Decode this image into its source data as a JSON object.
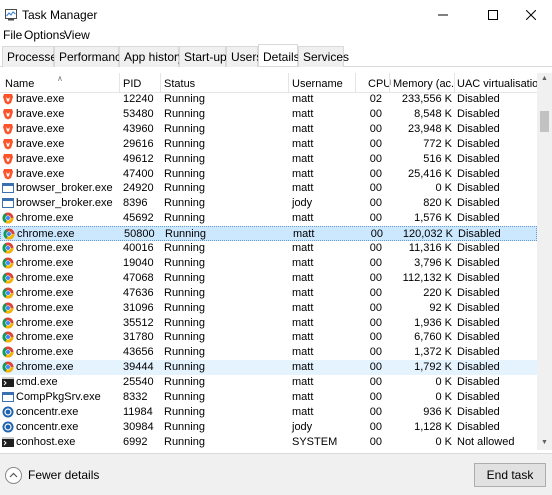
{
  "window": {
    "title": "Task Manager"
  },
  "menu": {
    "file": "File",
    "options": "Options",
    "view": "View"
  },
  "tabs": [
    {
      "label": "Processes"
    },
    {
      "label": "Performance"
    },
    {
      "label": "App history"
    },
    {
      "label": "Start-up"
    },
    {
      "label": "Users"
    },
    {
      "label": "Details",
      "active": true
    },
    {
      "label": "Services"
    }
  ],
  "columns": {
    "name": "Name",
    "pid": "PID",
    "status": "Status",
    "username": "Username",
    "cpu": "CPU",
    "memory": "Memory (ac...",
    "uac": "UAC virtualisation"
  },
  "rows": [
    {
      "name": "brave.exe",
      "pid": "12240",
      "status": "Running",
      "user": "matt",
      "cpu": "02",
      "mem": "233,556 K",
      "uac": "Disabled",
      "icon": "brave"
    },
    {
      "name": "brave.exe",
      "pid": "53480",
      "status": "Running",
      "user": "matt",
      "cpu": "00",
      "mem": "8,548 K",
      "uac": "Disabled",
      "icon": "brave"
    },
    {
      "name": "brave.exe",
      "pid": "43960",
      "status": "Running",
      "user": "matt",
      "cpu": "00",
      "mem": "23,948 K",
      "uac": "Disabled",
      "icon": "brave"
    },
    {
      "name": "brave.exe",
      "pid": "29616",
      "status": "Running",
      "user": "matt",
      "cpu": "00",
      "mem": "772 K",
      "uac": "Disabled",
      "icon": "brave"
    },
    {
      "name": "brave.exe",
      "pid": "49612",
      "status": "Running",
      "user": "matt",
      "cpu": "00",
      "mem": "516 K",
      "uac": "Disabled",
      "icon": "brave"
    },
    {
      "name": "brave.exe",
      "pid": "47400",
      "status": "Running",
      "user": "matt",
      "cpu": "00",
      "mem": "25,416 K",
      "uac": "Disabled",
      "icon": "brave"
    },
    {
      "name": "browser_broker.exe",
      "pid": "24920",
      "status": "Running",
      "user": "matt",
      "cpu": "00",
      "mem": "0 K",
      "uac": "Disabled",
      "icon": "app"
    },
    {
      "name": "browser_broker.exe",
      "pid": "8396",
      "status": "Running",
      "user": "jody",
      "cpu": "00",
      "mem": "820 K",
      "uac": "Disabled",
      "icon": "app"
    },
    {
      "name": "chrome.exe",
      "pid": "45692",
      "status": "Running",
      "user": "matt",
      "cpu": "00",
      "mem": "1,576 K",
      "uac": "Disabled",
      "icon": "chrome"
    },
    {
      "name": "chrome.exe",
      "pid": "50800",
      "status": "Running",
      "user": "matt",
      "cpu": "00",
      "mem": "120,032 K",
      "uac": "Disabled",
      "icon": "chrome",
      "state": "selected"
    },
    {
      "name": "chrome.exe",
      "pid": "40016",
      "status": "Running",
      "user": "matt",
      "cpu": "00",
      "mem": "11,316 K",
      "uac": "Disabled",
      "icon": "chrome"
    },
    {
      "name": "chrome.exe",
      "pid": "19040",
      "status": "Running",
      "user": "matt",
      "cpu": "00",
      "mem": "3,796 K",
      "uac": "Disabled",
      "icon": "chrome"
    },
    {
      "name": "chrome.exe",
      "pid": "47068",
      "status": "Running",
      "user": "matt",
      "cpu": "00",
      "mem": "112,132 K",
      "uac": "Disabled",
      "icon": "chrome"
    },
    {
      "name": "chrome.exe",
      "pid": "47636",
      "status": "Running",
      "user": "matt",
      "cpu": "00",
      "mem": "220 K",
      "uac": "Disabled",
      "icon": "chrome"
    },
    {
      "name": "chrome.exe",
      "pid": "31096",
      "status": "Running",
      "user": "matt",
      "cpu": "00",
      "mem": "92 K",
      "uac": "Disabled",
      "icon": "chrome"
    },
    {
      "name": "chrome.exe",
      "pid": "35512",
      "status": "Running",
      "user": "matt",
      "cpu": "00",
      "mem": "1,936 K",
      "uac": "Disabled",
      "icon": "chrome"
    },
    {
      "name": "chrome.exe",
      "pid": "31780",
      "status": "Running",
      "user": "matt",
      "cpu": "00",
      "mem": "6,760 K",
      "uac": "Disabled",
      "icon": "chrome"
    },
    {
      "name": "chrome.exe",
      "pid": "43656",
      "status": "Running",
      "user": "matt",
      "cpu": "00",
      "mem": "1,372 K",
      "uac": "Disabled",
      "icon": "chrome"
    },
    {
      "name": "chrome.exe",
      "pid": "39444",
      "status": "Running",
      "user": "matt",
      "cpu": "00",
      "mem": "1,792 K",
      "uac": "Disabled",
      "icon": "chrome",
      "state": "hover"
    },
    {
      "name": "cmd.exe",
      "pid": "25540",
      "status": "Running",
      "user": "matt",
      "cpu": "00",
      "mem": "0 K",
      "uac": "Disabled",
      "icon": "cmd"
    },
    {
      "name": "CompPkgSrv.exe",
      "pid": "8332",
      "status": "Running",
      "user": "matt",
      "cpu": "00",
      "mem": "0 K",
      "uac": "Disabled",
      "icon": "app"
    },
    {
      "name": "concentr.exe",
      "pid": "11984",
      "status": "Running",
      "user": "matt",
      "cpu": "00",
      "mem": "936 K",
      "uac": "Disabled",
      "icon": "citrix"
    },
    {
      "name": "concentr.exe",
      "pid": "30984",
      "status": "Running",
      "user": "jody",
      "cpu": "00",
      "mem": "1,128 K",
      "uac": "Disabled",
      "icon": "citrix"
    },
    {
      "name": "conhost.exe",
      "pid": "6992",
      "status": "Running",
      "user": "SYSTEM",
      "cpu": "00",
      "mem": "0 K",
      "uac": "Not allowed",
      "icon": "cmd"
    }
  ],
  "footer": {
    "fewer_details": "Fewer details",
    "end_task": "End task"
  }
}
